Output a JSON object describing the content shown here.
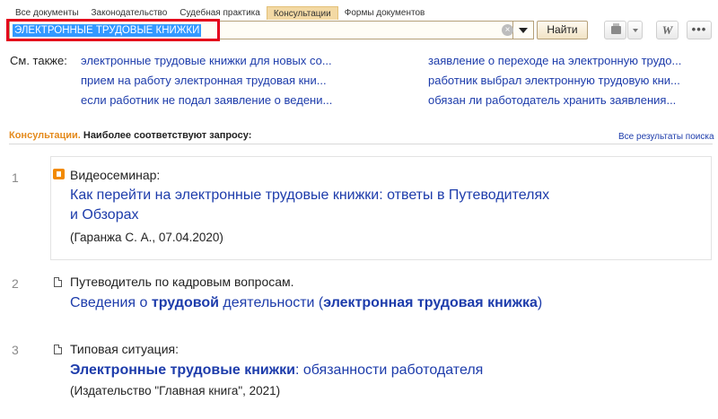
{
  "tabs": [
    {
      "label": "Все документы"
    },
    {
      "label": "Законодательство"
    },
    {
      "label": "Судебная практика"
    },
    {
      "label": "Консультации"
    },
    {
      "label": "Формы документов"
    }
  ],
  "active_tab": "Консультации",
  "search": {
    "value": "ЭЛЕКТРОННЫЕ ТРУДОВЫЕ КНИЖКИ",
    "find_label": "Найти"
  },
  "toolbar": {
    "print_icon": "printer-icon",
    "word_icon": "W",
    "more_icon": "•••"
  },
  "see_also": {
    "label": "См. также:",
    "links": [
      "электронные трудовые книжки для новых со...",
      "прием на работу электронная трудовая кни...",
      "если работник не подал заявление о ведени...",
      "заявление о переходе на электронную трудо...",
      "работник выбрал электронную трудовую кни...",
      "обязан ли работодатель хранить заявления..."
    ]
  },
  "section": {
    "title_orange": "Консультации.",
    "title_dark": "Наиболее соответствуют запросу:",
    "all_results": "Все результаты поиска"
  },
  "results": [
    {
      "num": "1",
      "kind": "Видеосеминар:",
      "title_line1": "Как перейти на электронные трудовые книжки: ответы в Путеводителях",
      "title_line2": "и Обзорах",
      "meta": "(Гаранжа С. А., 07.04.2020)"
    },
    {
      "num": "2",
      "kind": "Путеводитель по кадровым вопросам.",
      "title_parts": [
        "Сведения о ",
        "трудовой",
        " деятельности (",
        "электронная трудовая книжка",
        ")"
      ]
    },
    {
      "num": "3",
      "kind": "Типовая ситуация:",
      "title_parts": [
        "Электронные трудовые книжки",
        ": обязанности работодателя"
      ],
      "meta": "(Издательство \"Главная книга\", 2021)"
    }
  ]
}
